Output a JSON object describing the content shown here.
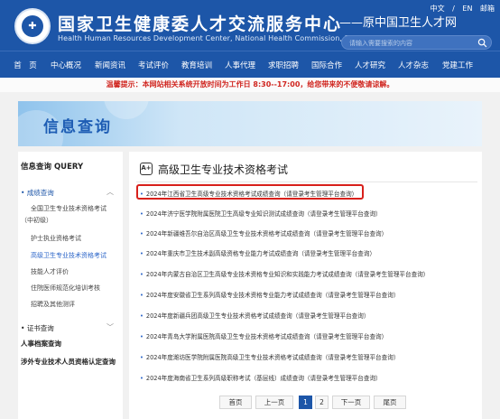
{
  "header": {
    "title": "国家卫生健康委人才交流服务中心",
    "subtitle": "Health Human Resources Development Center, National Health Commission, P.R.China",
    "former_name": "——原中国卫生人才网",
    "links": [
      "中文",
      "EN",
      "邮箱"
    ],
    "search_placeholder": "请输入需要搜索的内容"
  },
  "nav": [
    "首　页",
    "中心概况",
    "新闻资讯",
    "考试评价",
    "教育培训",
    "人事代理",
    "求职招聘",
    "国际合作",
    "人才研究",
    "人才杂志",
    "党建工作"
  ],
  "notice": "温馨提示：本网站相关系统开放时间为工作日 8:30--17:00，给您带来的不便敬请谅解。",
  "banner": {
    "title": "信息查询"
  },
  "sidebar": {
    "title": "信息查询 QUERY",
    "group1": "成绩查询",
    "group1_items": [
      "全国卫生专业技术资格考试",
      "（中初级）",
      "护士执业资格考试",
      "高级卫生专业技术资格考试",
      "技能人才评价",
      "住院医师规范化培训考核",
      "招聘及其他测评"
    ],
    "group2": "证书查询",
    "main_items": [
      "人事档案查询",
      "涉外专业技术人员资格认定查询"
    ]
  },
  "content": {
    "title": "高级卫生专业技术资格考试",
    "icon_text": "A+",
    "rows": [
      "2024年江西省卫生高级专业技术资格考试成绩查询（请登录考生管理平台查询）",
      "2024年济宁医学院附属医院卫生高级专业知识测试成绩查询（请登录考生管理平台查询）",
      "2024年新疆维吾尔自治区高级卫生专业技术资格考试成绩查询（请登录考生管理平台查询）",
      "2024年重庆市卫生技术副高级资格专业能力考试成绩查询（请登录考生管理平台查询）",
      "2024年内蒙古自治区卫生高级专业技术资格专业知识和实践能力考试成绩查询（请登录考生管理平台查询）",
      "2024年度安徽省卫生系列高级专业技术资格专业能力考试成绩查询（请登录考生管理平台查询）",
      "2024年度新疆兵团高级卫生专业技术资格考试成绩查询（请登录考生管理平台查询）",
      "2024年青岛大学附属医院高级卫生专业技术资格考试成绩查询（请登录考生管理平台查询）",
      "2024年度潍坊医学院附属医院高级卫生专业技术资格考试成绩查询（请登录考生管理平台查询）",
      "2024年度海南省卫生系列高级职称考试（基层线）成绩查询（请登录考生管理平台查询）"
    ]
  },
  "pagination": {
    "first": "首页",
    "prev": "上一页",
    "page1": "1",
    "page2": "2",
    "next": "下一页",
    "last": "尾页"
  },
  "colors": {
    "brand": "#1d56a8",
    "highlight": "#d8201b",
    "notice": "#d0251f"
  }
}
